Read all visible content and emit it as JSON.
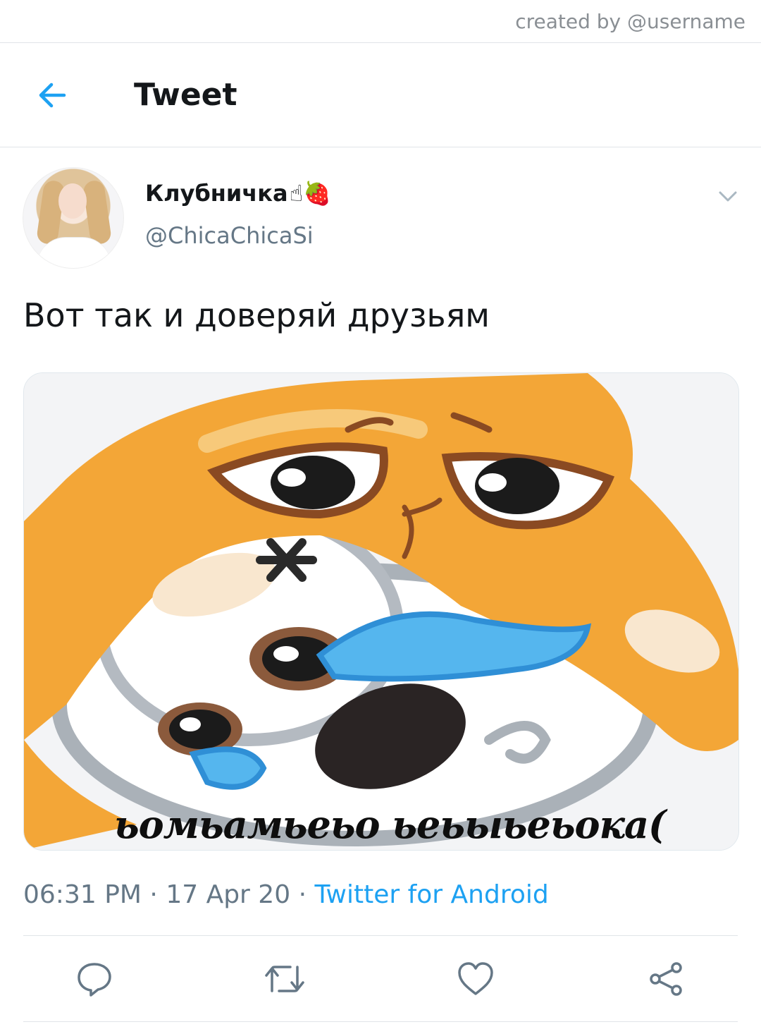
{
  "watermark": {
    "text": "created by @username"
  },
  "header": {
    "title": "Tweet",
    "back_icon": "arrow-left-icon"
  },
  "colors": {
    "accent": "#1da1f2",
    "text_primary": "#14171a",
    "text_secondary": "#657786",
    "divider": "#e1e4e8"
  },
  "tweet": {
    "author": {
      "display_name": "Клубничка",
      "emojis": "☝🍓",
      "handle": "@ChicaChicaSi"
    },
    "text": "Вот так и доверяй друзьям",
    "media": {
      "caption": "ьомьамьеьо ьеьыьеьока("
    },
    "time": "06:31 PM",
    "date": "17 Apr 20",
    "separator": "·",
    "source": "Twitter for Android"
  },
  "actions": {
    "reply_icon": "reply-icon",
    "retweet_icon": "retweet-icon",
    "like_icon": "heart-icon",
    "share_icon": "share-icon"
  }
}
